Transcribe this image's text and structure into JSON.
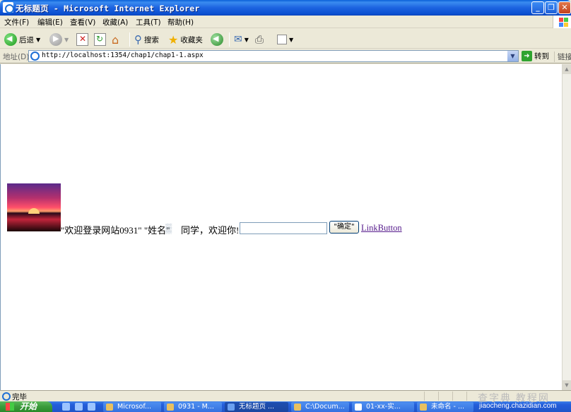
{
  "window": {
    "title": "无标题页 - Microsoft Internet Explorer",
    "controls": {
      "minimize": "_",
      "maximize": "❐",
      "close": "✕"
    }
  },
  "menu": [
    "文件(F)",
    "编辑(E)",
    "查看(V)",
    "收藏(A)",
    "工具(T)",
    "帮助(H)"
  ],
  "toolbar": {
    "back_label": "后退",
    "search_label": "搜索",
    "favorites_label": "收藏夹"
  },
  "address": {
    "label": "地址(D)",
    "url": "http://localhost:1354/chap1/chap1-1.aspx",
    "go_label": "转到",
    "links_label": "链接"
  },
  "page": {
    "welcome_text": "\"欢迎登录网站0931\" \"姓名\"",
    "greeting_text": "同学，欢迎你!",
    "name_value": "",
    "ok_button": "\"确定\"",
    "link_button": "LinkButton"
  },
  "status": {
    "text": "完毕"
  },
  "taskbar": {
    "start_label": "开始",
    "tasks": [
      "Microsof...",
      "0931 - M...",
      "无标题页 ...",
      "C:\\Docum...",
      "01-xx-实...",
      "未命名 - ..."
    ]
  },
  "watermark": {
    "line1": "查字典 教程网",
    "line2": "jiaocheng.chazidian.com"
  }
}
